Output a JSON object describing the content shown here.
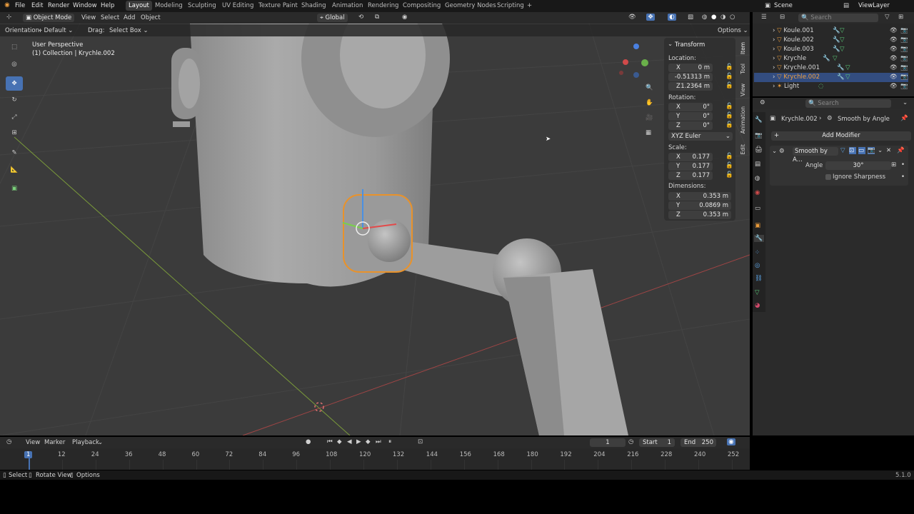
{
  "topbar": {
    "menus": [
      "File",
      "Edit",
      "Render",
      "Window",
      "Help"
    ],
    "tabs": [
      "Layout",
      "Modeling",
      "Sculpting",
      "UV Editing",
      "Texture Paint",
      "Shading",
      "Animation",
      "Rendering",
      "Compositing",
      "Geometry Nodes",
      "Scripting"
    ],
    "active_tab": "Layout",
    "plus": "+",
    "scene": "Scene",
    "view_layer": "ViewLayer"
  },
  "viewport_header": {
    "mode": "Object Mode",
    "menus": [
      "View",
      "Select",
      "Add",
      "Object"
    ],
    "transform_space": "Global"
  },
  "tool_settings": {
    "orientation_label": "Orientation:",
    "orientation_value": "Default",
    "drag_label": "Drag:",
    "drag_value": "Select Box",
    "options": "Options"
  },
  "viewport": {
    "title": "User Perspective",
    "subtitle": "(1) Collection | Krychle.002"
  },
  "npanel": {
    "section": "Transform",
    "location_label": "Location:",
    "location": [
      {
        "axis": "X",
        "value": "0 m"
      },
      {
        "axis": "Y",
        "value": "-0.51313 m"
      },
      {
        "axis": "Z",
        "value": "1.2364 m"
      }
    ],
    "rotation_label": "Rotation:",
    "rotation": [
      {
        "axis": "X",
        "value": "0°"
      },
      {
        "axis": "Y",
        "value": "0°"
      },
      {
        "axis": "Z",
        "value": "0°"
      }
    ],
    "rotation_mode": "XYZ Euler",
    "scale_label": "Scale:",
    "scale": [
      {
        "axis": "X",
        "value": "0.177"
      },
      {
        "axis": "Y",
        "value": "0.177"
      },
      {
        "axis": "Z",
        "value": "0.177"
      }
    ],
    "dimensions_label": "Dimensions:",
    "dimensions": [
      {
        "axis": "X",
        "value": "0.353 m"
      },
      {
        "axis": "Y",
        "value": "0.0869 m"
      },
      {
        "axis": "Z",
        "value": "0.353 m"
      }
    ],
    "tabs": [
      "Item",
      "Tool",
      "View",
      "Animation",
      "Edit"
    ]
  },
  "outliner": {
    "search_placeholder": "Search",
    "items": [
      "Koule.001",
      "Koule.002",
      "Koule.003",
      "Krychle",
      "Krychle.001",
      "Krychle.002",
      "Light"
    ],
    "selected": "Krychle.002"
  },
  "properties": {
    "search_placeholder": "Search",
    "object": "Krychle.002",
    "modifier_crumb": "Smooth by Angle",
    "add_modifier": "Add Modifier",
    "modifier_name": "Smooth by A...",
    "angle_label": "Angle",
    "angle_value": "30°",
    "ignore_sharpness": "Ignore Sharpness"
  },
  "timeline": {
    "menus": [
      "View",
      "Marker",
      "Playback"
    ],
    "current_frame": "1",
    "start_label": "Start",
    "start": "1",
    "end_label": "End",
    "end": "250",
    "ticks": [
      "1",
      "12",
      "24",
      "36",
      "48",
      "60",
      "72",
      "84",
      "96",
      "108",
      "120",
      "132",
      "144",
      "156",
      "168",
      "180",
      "192",
      "204",
      "216",
      "228",
      "240",
      "252"
    ]
  },
  "statusbar": {
    "select": "Select",
    "rotate": "Rotate View",
    "options": "Options",
    "version": "5.1.0"
  }
}
